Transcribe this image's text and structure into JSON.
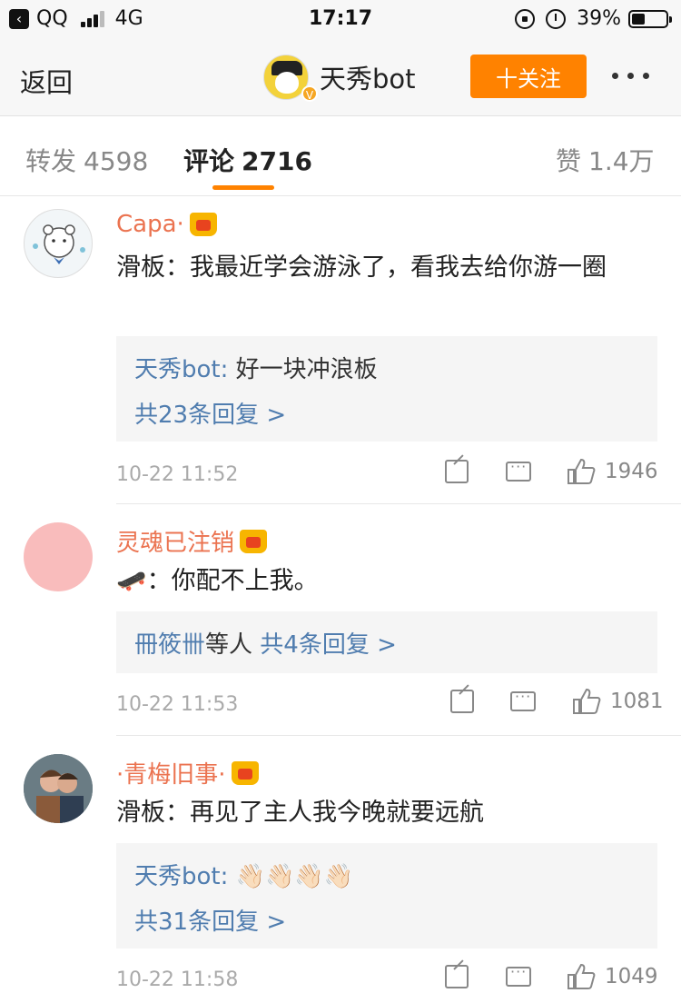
{
  "status_bar": {
    "back_app": "QQ",
    "network": "4G",
    "time": "17:17",
    "battery": "39%",
    "battery_level": 0.39
  },
  "nav": {
    "back_label": "返回",
    "title": "天秀bot",
    "verified_badge": "V",
    "follow_label": "十关注",
    "more_icon": "more-dots-icon"
  },
  "tabs": [
    {
      "label": "转发",
      "count": "4598"
    },
    {
      "label": "评论",
      "count": "2716"
    },
    {
      "label": "赞",
      "count": "1.4万"
    }
  ],
  "comments": [
    {
      "name": "Capa·",
      "text": "滑板：我最近学会游泳了，看我去给你游一圈",
      "reply_line1_user": "天秀bot:",
      "reply_line1_text": " 好一块冲浪板",
      "reply_line2": "共23条回复 >",
      "time": "10-22 11:52",
      "likes": "1946"
    },
    {
      "name": "灵魂已注销",
      "text": "🛹：你配不上我。",
      "reply_line1_user": "冊筱卌",
      "reply_line1_text": "等人",
      "reply_line1_extra": "  共4条回复 >",
      "time": "10-22 11:53",
      "likes": "1081"
    },
    {
      "name": "·青梅旧事·",
      "text": "滑板：再见了主人我今晚就要远航",
      "reply_line1_user": "天秀bot:",
      "reply_line1_text": " 👋🏻👋🏻👋🏻👋🏻",
      "reply_line2": "共31条回复 >",
      "time": "10-22 11:58",
      "likes": "1049"
    }
  ],
  "colors": {
    "accent": "#ff8200",
    "username": "#eb7350",
    "link": "#507daf"
  }
}
